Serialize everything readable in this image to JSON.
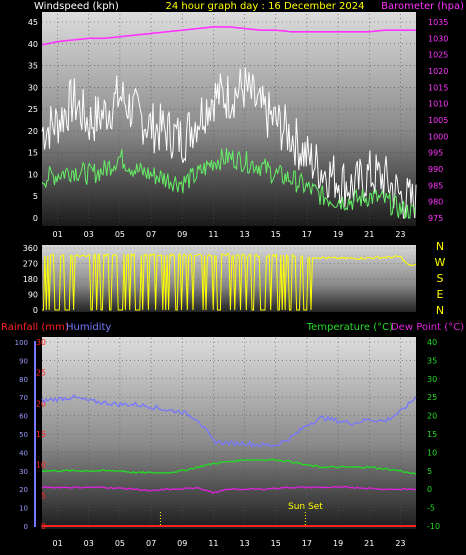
{
  "colors": {
    "background": "#000000",
    "wind_title": "#ffffff",
    "title": "#ffff00",
    "barometer": "#ff33ff",
    "gust": "#ffffff",
    "wind_avg": "#66ee66",
    "direction": "#ffff00",
    "rainfall": "#ff2222",
    "humidity": "#7777ff",
    "temperature": "#22dd22",
    "dew_point": "#dd22dd",
    "compass": "#ffff00",
    "sunset": "#ffff00"
  },
  "header": {
    "wind_label": "Windspeed (kph)",
    "title": "24 hour graph day : 16 December 2024",
    "barometer_label": "Barometer (hpa)"
  },
  "middle": {
    "compass": [
      "N",
      "W",
      "S",
      "E",
      "N"
    ]
  },
  "lower_header": {
    "rainfall_label": "Rainfall (mm)",
    "humidity_label": "Humidity",
    "temperature_label": "Temperature (°C)",
    "dewpoint_label": "Dew Point (°C)"
  },
  "annotation": {
    "sunset_label": "Sun Set"
  },
  "chart_data": [
    {
      "type": "line",
      "name": "wind_and_pressure",
      "x_ticks": [
        "01",
        "03",
        "05",
        "07",
        "09",
        "11",
        "13",
        "15",
        "17",
        "19",
        "21",
        "23"
      ],
      "xlim": [
        0,
        24
      ],
      "ylim_left": [
        0,
        45
      ],
      "yticks_left": [
        0,
        5,
        10,
        15,
        20,
        25,
        30,
        35,
        40,
        45
      ],
      "ylim_right": [
        975,
        1035
      ],
      "yticks_right": [
        975,
        980,
        985,
        990,
        995,
        1000,
        1005,
        1010,
        1015,
        1020,
        1025,
        1030,
        1035
      ],
      "gust": {
        "hours": [
          0,
          1,
          2,
          3,
          4,
          5,
          6,
          7,
          8,
          9,
          10,
          11,
          12,
          13,
          14,
          15,
          16,
          17,
          18,
          19,
          20,
          21,
          22,
          23,
          24
        ],
        "values": [
          20,
          22,
          27,
          22,
          24,
          28,
          24,
          21,
          20,
          18,
          23,
          28,
          28,
          30,
          25,
          22,
          19,
          14,
          11,
          9,
          7,
          10,
          9,
          5,
          3
        ]
      },
      "wind_avg": {
        "hours": [
          0,
          1,
          2,
          3,
          4,
          5,
          6,
          7,
          8,
          9,
          10,
          11,
          12,
          13,
          14,
          15,
          16,
          17,
          18,
          19,
          20,
          21,
          22,
          23,
          24
        ],
        "values": [
          9,
          10,
          11,
          10,
          11,
          14,
          11,
          10,
          9,
          8,
          10,
          13,
          14,
          13,
          12,
          10,
          9,
          7,
          5,
          4,
          4,
          5,
          4,
          2,
          1
        ]
      },
      "barometer": {
        "hours": [
          0,
          1,
          2,
          3,
          4,
          5,
          6,
          7,
          8,
          9,
          10,
          11,
          12,
          13,
          14,
          15,
          16,
          17,
          18,
          19,
          20,
          21,
          22,
          23,
          24
        ],
        "values": [
          1028,
          1029,
          1029.5,
          1030,
          1030,
          1030.5,
          1031,
          1031.5,
          1032,
          1032.5,
          1033,
          1033.5,
          1033.5,
          1033,
          1032.5,
          1032.5,
          1032,
          1032,
          1032,
          1032,
          1032,
          1032,
          1032.5,
          1032.5,
          1032.5
        ]
      }
    },
    {
      "type": "line",
      "name": "wind_direction",
      "xlim": [
        0,
        24
      ],
      "ylim": [
        0,
        360
      ],
      "yticks": [
        0,
        90,
        180,
        270,
        360
      ],
      "hours": [
        0,
        2,
        4,
        6,
        8,
        10,
        12,
        14,
        16,
        17,
        18.5,
        20,
        22,
        23,
        23.5,
        24
      ],
      "values": [
        320,
        315,
        318,
        322,
        320,
        318,
        320,
        316,
        315,
        310,
        300,
        300,
        305,
        310,
        260,
        260
      ]
    },
    {
      "type": "line",
      "name": "temperature_humidity",
      "x_ticks": [
        "01",
        "03",
        "05",
        "07",
        "09",
        "11",
        "13",
        "15",
        "17",
        "19",
        "21",
        "23"
      ],
      "xlim": [
        0,
        24
      ],
      "ylim_rain": [
        0,
        30
      ],
      "yticks_rain": [
        0,
        5,
        10,
        15,
        20,
        25,
        30
      ],
      "ylim_humidity": [
        0,
        100
      ],
      "yticks_humidity": [
        0,
        10,
        20,
        30,
        40,
        50,
        60,
        70,
        80,
        90,
        100
      ],
      "ylim_temp": [
        -10,
        40
      ],
      "yticks_temp": [
        -10,
        -5,
        0,
        5,
        10,
        15,
        20,
        25,
        30,
        35,
        40
      ],
      "humidity": {
        "hours": [
          0,
          1,
          2,
          3,
          4,
          5,
          6,
          7,
          8,
          9,
          10,
          11,
          12,
          13,
          14,
          15,
          16,
          17,
          18,
          19,
          20,
          21,
          22,
          23,
          24
        ],
        "values": [
          68,
          69,
          70,
          68,
          67,
          66,
          66,
          65,
          63,
          62,
          58,
          46,
          45,
          45,
          44,
          44,
          48,
          55,
          59,
          57,
          56,
          58,
          57,
          62,
          70
        ]
      },
      "temperature": {
        "hours": [
          0,
          1,
          2,
          3,
          4,
          5,
          6,
          7,
          8,
          9,
          10,
          11,
          12,
          13,
          14,
          15,
          16,
          17,
          18,
          19,
          20,
          21,
          22,
          23,
          24
        ],
        "values": [
          5,
          5,
          5,
          5,
          5,
          5,
          4.5,
          4.5,
          4.5,
          5,
          6,
          7,
          7.5,
          8,
          8,
          8,
          7.5,
          6.5,
          6,
          6,
          6,
          6,
          5.5,
          5,
          4
        ]
      },
      "dew_point": {
        "hours": [
          0,
          2,
          4,
          6,
          7,
          8,
          9,
          10,
          11,
          12,
          14,
          16,
          18,
          20,
          22,
          24
        ],
        "values": [
          0.5,
          0.5,
          0.5,
          0,
          -0.5,
          0,
          0,
          0.5,
          -1,
          0,
          0,
          0.5,
          0.5,
          0.5,
          0,
          0
        ]
      },
      "rainfall": {
        "hours": [
          0,
          24
        ],
        "values": [
          0,
          0
        ]
      },
      "sunset_hour": 16.9,
      "marker_hour": 7.6
    }
  ]
}
